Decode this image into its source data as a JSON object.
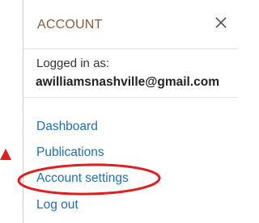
{
  "panel": {
    "title": "ACCOUNT",
    "close_icon": "close-icon"
  },
  "user": {
    "logged_in_label": "Logged in as:",
    "email": "awilliamsnashville@gmail.com"
  },
  "menu": {
    "items": [
      {
        "label": "Dashboard"
      },
      {
        "label": "Publications"
      },
      {
        "label": "Account settings",
        "highlighted": true
      },
      {
        "label": "Log out"
      }
    ]
  },
  "annotations": {
    "highlight_color": "#e31d1d",
    "link_color": "#1f6fb3",
    "title_color": "#8a5a3c"
  }
}
